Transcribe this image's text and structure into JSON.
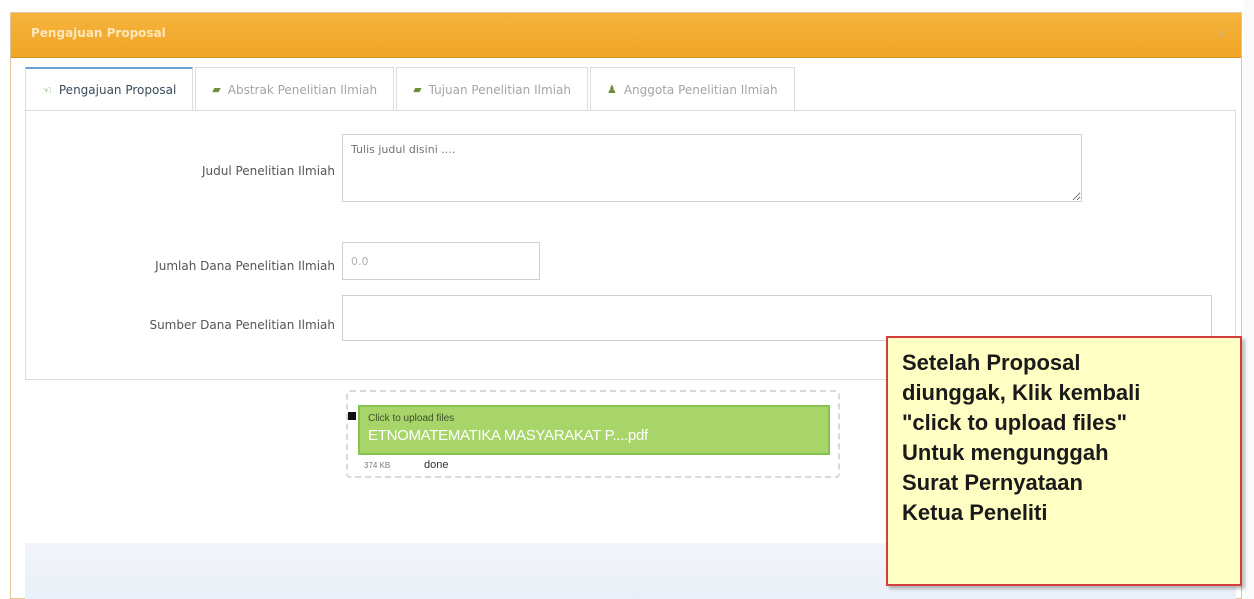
{
  "dialog": {
    "title": "Pengajuan Proposal",
    "close_glyph": "×"
  },
  "tabs": [
    {
      "label": "Pengajuan Proposal",
      "icon": "bullhorn-icon",
      "glyph": "☜",
      "active": true
    },
    {
      "label": "Abstrak Penelitian Ilmiah",
      "icon": "book-icon",
      "glyph": "▰",
      "active": false
    },
    {
      "label": "Tujuan Penelitian Ilmiah",
      "icon": "book-icon",
      "glyph": "▰",
      "active": false
    },
    {
      "label": "Anggota Penelitian Ilmiah",
      "icon": "user-icon",
      "glyph": "♟",
      "active": false
    }
  ],
  "form": {
    "judul_label": "Judul Penelitian Ilmiah",
    "judul_placeholder": "Tulis judul disini ....",
    "judul_value": "",
    "dana_label": "Jumlah Dana Penelitian Ilmiah",
    "dana_value": "0.0",
    "sumber_label": "Sumber Dana Penelitian Ilmiah",
    "sumber_value": ""
  },
  "upload": {
    "cta": "Click to upload files",
    "file_name": "ETNOMATEMATIKA MASYARAKAT P....pdf",
    "file_size": "374 KB",
    "status": "done"
  },
  "callout": {
    "text": "Setelah Proposal\ndiunggak, Klik kembali\n\"click to upload files\"\nUntuk mengunggah\nSurat Pernyataan\nKetua Peneliti"
  },
  "colors": {
    "header": "#f0a62a",
    "upload_bar": "#a7d56a",
    "callout_bg": "#ffffc4",
    "callout_border": "#d43d3d",
    "active_tab_border": "#6aa0d3"
  }
}
